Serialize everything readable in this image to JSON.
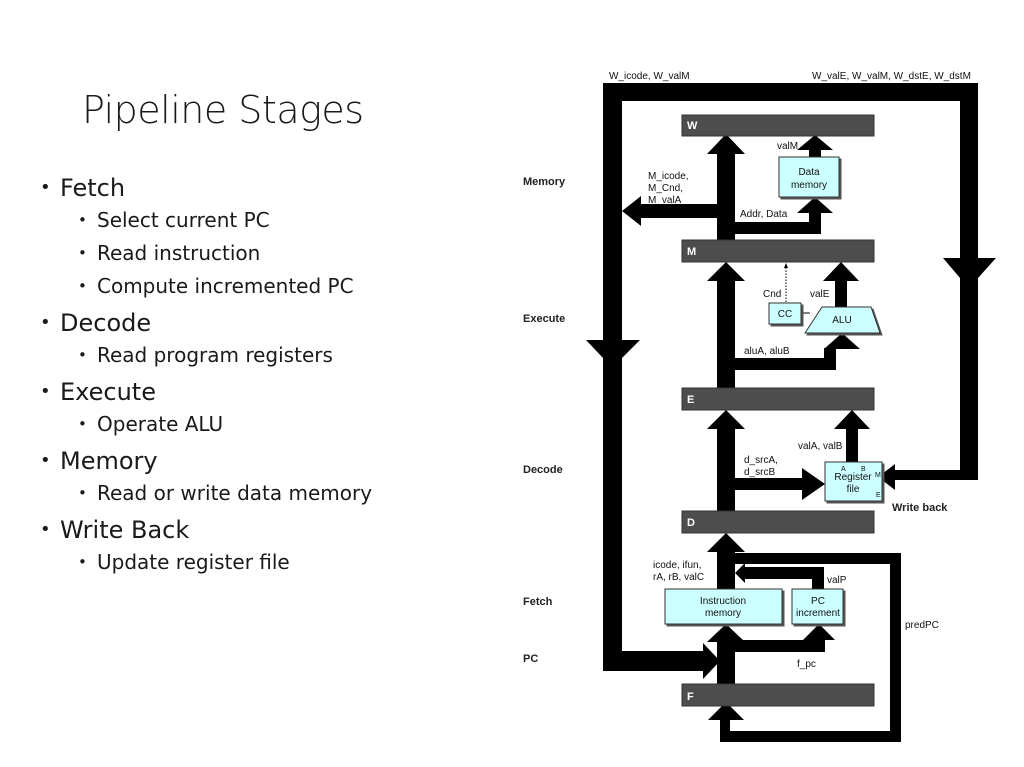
{
  "slide": {
    "title": "Pipeline Stages",
    "bullets": [
      {
        "label": "Fetch",
        "sub": [
          "Select current PC",
          "Read instruction",
          "Compute incremented PC"
        ]
      },
      {
        "label": "Decode",
        "sub": [
          "Read program registers"
        ]
      },
      {
        "label": "Execute",
        "sub": [
          "Operate ALU"
        ]
      },
      {
        "label": "Memory",
        "sub": [
          "Read or write data memory"
        ]
      },
      {
        "label": "Write Back",
        "sub": [
          "Update register file"
        ]
      }
    ]
  },
  "diagram": {
    "colors": {
      "bus": "#000000",
      "pipeline_register": "#4d4d4d",
      "unit_fill": "#ccffff"
    },
    "stage_labels": {
      "memory": "Memory",
      "execute": "Execute",
      "decode": "Decode",
      "fetch": "Fetch",
      "pc": "PC"
    },
    "pipeline_registers": {
      "w": "W",
      "m": "M",
      "e": "E",
      "d": "D",
      "f": "F"
    },
    "units": {
      "data_memory": [
        "Data",
        "memory"
      ],
      "alu": "ALU",
      "cc": "CC",
      "register_file": [
        "Register",
        "file"
      ],
      "register_file_ports": {
        "a": "A",
        "b": "B",
        "m": "M",
        "e": "E"
      },
      "instruction_memory": [
        "Instruction",
        "memory"
      ],
      "pc_increment": [
        "PC",
        "increment"
      ]
    },
    "signals": {
      "w_icode_valm": "W_icode, W_valM",
      "w_writeback": "W_valE, W_valM, W_dstE, W_dstM",
      "valm": "valM",
      "m_signals": [
        "M_icode,",
        "M_Cnd,",
        "M_valA"
      ],
      "addr_data": "Addr, Data",
      "cnd": "Cnd",
      "vale": "valE",
      "alua_alub": "aluA, aluB",
      "vala_valb": "valA, valB",
      "d_src": [
        "d_srcA,",
        "d_srcB"
      ],
      "write_back": "Write back",
      "fetch_outputs": [
        "icode, ifun,",
        "rA, rB, valC"
      ],
      "valp": "valP",
      "predpc": "predPC",
      "f_pc": "f_pc"
    }
  }
}
